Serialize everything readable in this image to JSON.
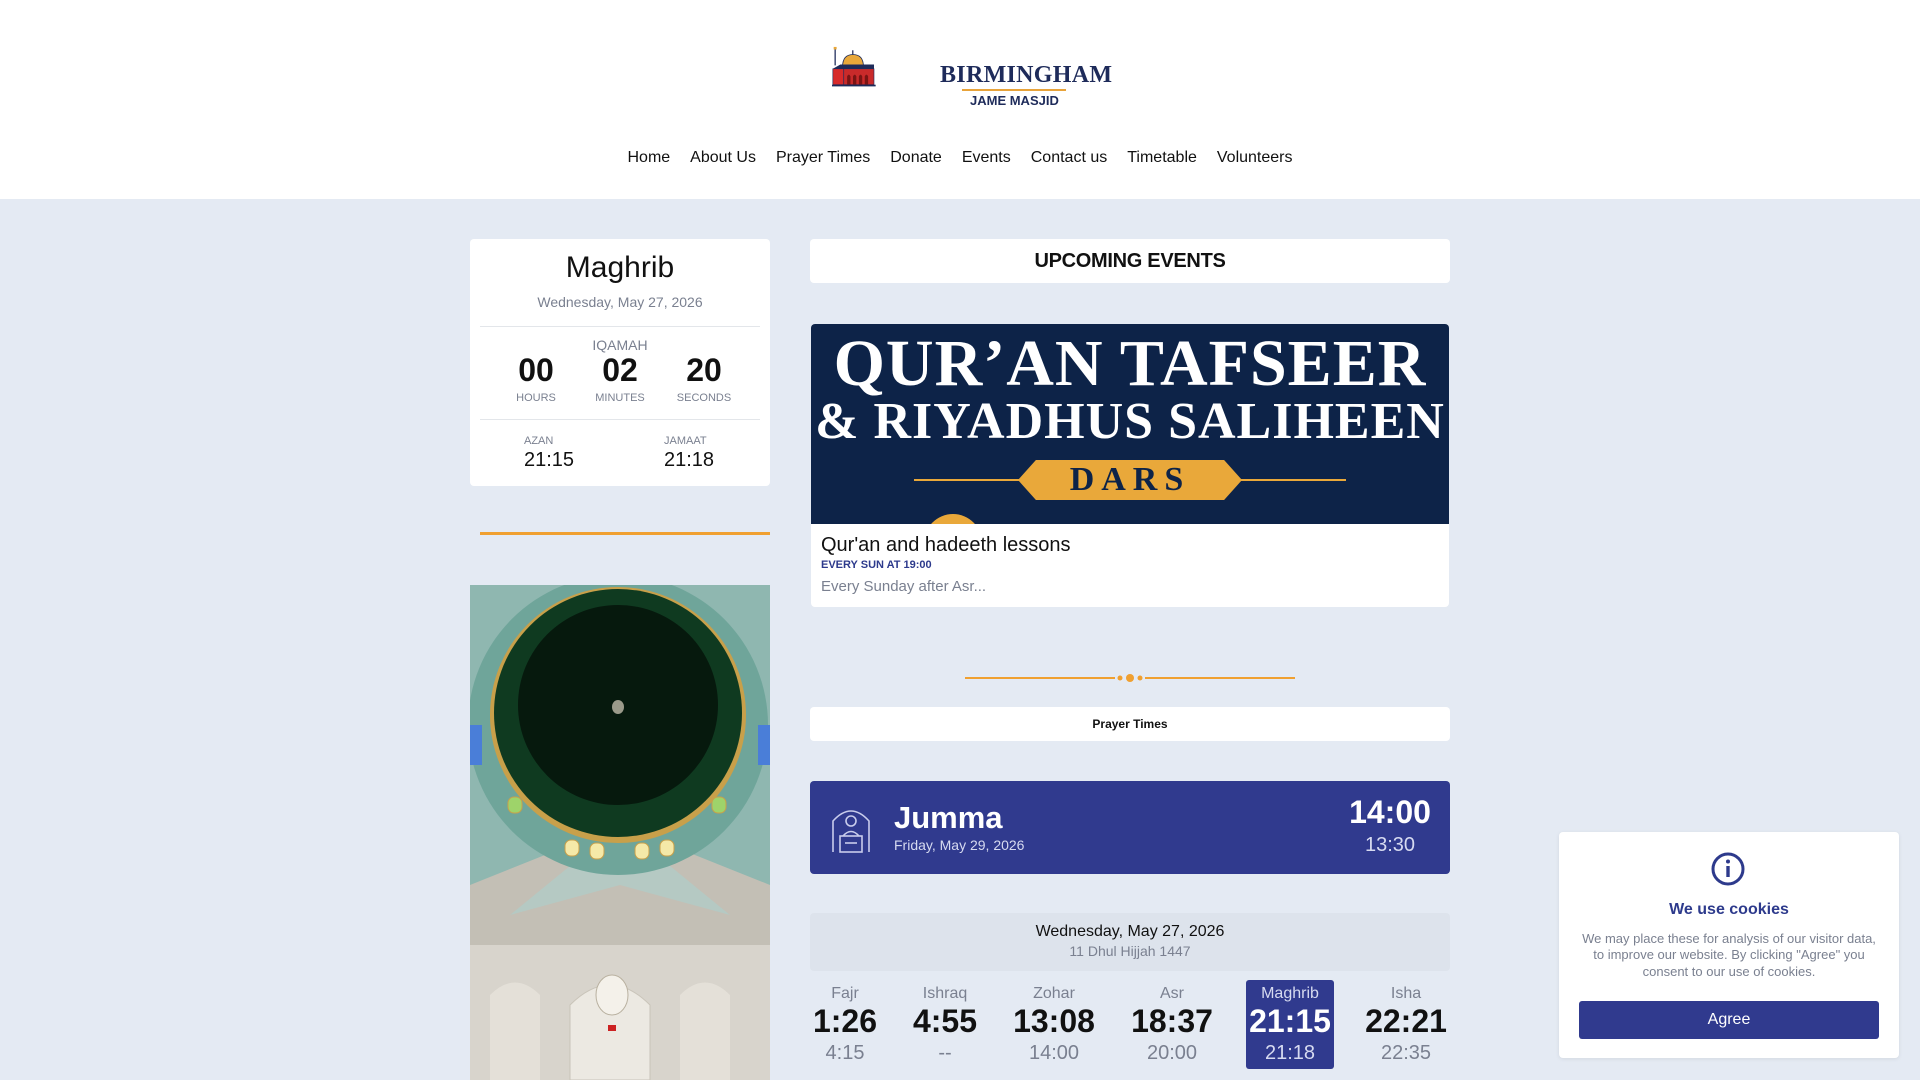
{
  "brand": {
    "name_line1": "BIRMINGHAM",
    "name_line2": "JAME MASJID",
    "logo_icon": "mosque-logo-icon"
  },
  "nav": [
    "Home",
    "About Us",
    "Prayer Times",
    "Donate",
    "Events",
    "Contact us",
    "Timetable",
    "Volunteers"
  ],
  "countdown": {
    "prayer": "Maghrib",
    "date": "Wednesday, May 27, 2026",
    "label": "IQAMAH",
    "hours": "00",
    "hours_label": "HOURS",
    "minutes": "02",
    "minutes_label": "MINUTES",
    "seconds": "20",
    "seconds_label": "SECONDS",
    "azan_label": "AZAN",
    "azan": "21:15",
    "jamaat_label": "JAMAAT",
    "jamaat": "21:18"
  },
  "events": {
    "header": "UPCOMING EVENTS",
    "banner_line1": "QUR’AN TAFSEER",
    "banner_line2": "& RIYADHUS SALIHEEN",
    "banner_pill": "DARS",
    "title": "Qur'an and hadeeth lessons",
    "when": "EVERY SUN AT 19:00",
    "desc": "Every Sunday after Asr..."
  },
  "prayer_times": {
    "header": "Prayer Times",
    "jumma": {
      "title": "Jumma",
      "date": "Friday, May 29, 2026",
      "time1": "14:00",
      "time2": "13:30",
      "icon": "imam-pulpit-icon"
    },
    "date": "Wednesday, May 27, 2026",
    "hijri": "11 Dhul Hijjah 1447",
    "prayers": [
      {
        "name": "Fajr",
        "time": "1:26",
        "jamaat": "4:15"
      },
      {
        "name": "Ishraq",
        "time": "4:55",
        "jamaat": "--"
      },
      {
        "name": "Zohar",
        "time": "13:08",
        "jamaat": "14:00"
      },
      {
        "name": "Asr",
        "time": "18:37",
        "jamaat": "20:00"
      },
      {
        "name": "Maghrib",
        "time": "21:15",
        "jamaat": "21:18",
        "active": true
      },
      {
        "name": "Isha",
        "time": "22:21",
        "jamaat": "22:35"
      }
    ]
  },
  "cookies": {
    "icon": "info-icon",
    "title": "We use cookies",
    "text": "We may place these for analysis of our visitor data, to improve our website. By clicking \"Agree\" you consent to our use of cookies.",
    "button": "Agree"
  },
  "colors": {
    "primary": "#303a8e",
    "accent": "#f0a030",
    "background": "#e4eaf3"
  }
}
